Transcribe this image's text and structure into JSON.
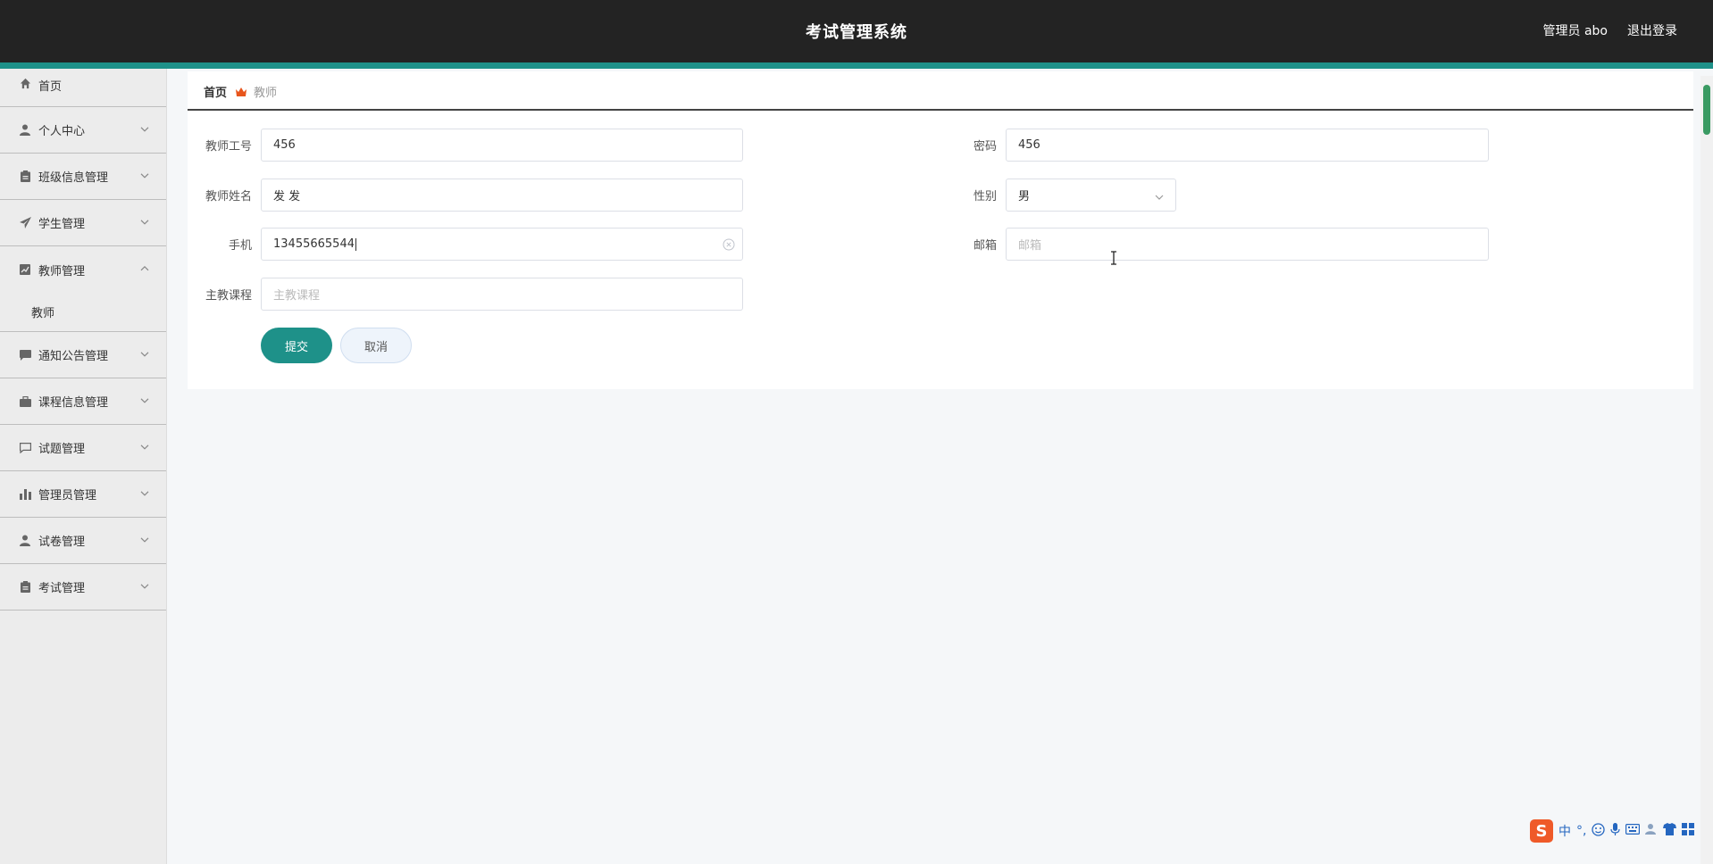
{
  "header": {
    "title": "考试管理系统",
    "user_label": "管理员 abo",
    "logout_label": "退出登录"
  },
  "sidebar": {
    "items": [
      {
        "label": "首页",
        "icon": "home-icon"
      },
      {
        "label": "个人中心",
        "icon": "user-icon"
      },
      {
        "label": "班级信息管理",
        "icon": "clipboard-icon"
      },
      {
        "label": "学生管理",
        "icon": "paper-plane-icon"
      },
      {
        "label": "教师管理",
        "icon": "chart-card-icon",
        "expanded": true
      },
      {
        "label": "通知公告管理",
        "icon": "message-icon"
      },
      {
        "label": "课程信息管理",
        "icon": "briefcase-icon"
      },
      {
        "label": "试题管理",
        "icon": "comment-icon"
      },
      {
        "label": "管理员管理",
        "icon": "bar-chart-icon"
      },
      {
        "label": "试卷管理",
        "icon": "user-icon"
      },
      {
        "label": "考试管理",
        "icon": "clipboard-icon"
      }
    ],
    "submenu": {
      "label": "教师"
    }
  },
  "breadcrumb": {
    "home": "首页",
    "current": "教师"
  },
  "form": {
    "teacher_id": {
      "label": "教师工号",
      "value": "456"
    },
    "password": {
      "label": "密码",
      "value": "456"
    },
    "teacher_name": {
      "label": "教师姓名",
      "value": "发 发"
    },
    "gender": {
      "label": "性别",
      "value": "男"
    },
    "phone": {
      "label": "手机",
      "value": "13455665544"
    },
    "email": {
      "label": "邮箱",
      "placeholder": "邮箱"
    },
    "main_course": {
      "label": "主教课程",
      "placeholder": "主教课程"
    },
    "submit_label": "提交",
    "cancel_label": "取消"
  },
  "ime": {
    "mode": "中",
    "punct": "°,"
  },
  "colors": {
    "header_bg": "#232323",
    "accent": "#1e9189",
    "sidebar_bg": "#ececec",
    "submit_btn": "#1e9189",
    "breadcrumb_icon": "#e8551c"
  }
}
